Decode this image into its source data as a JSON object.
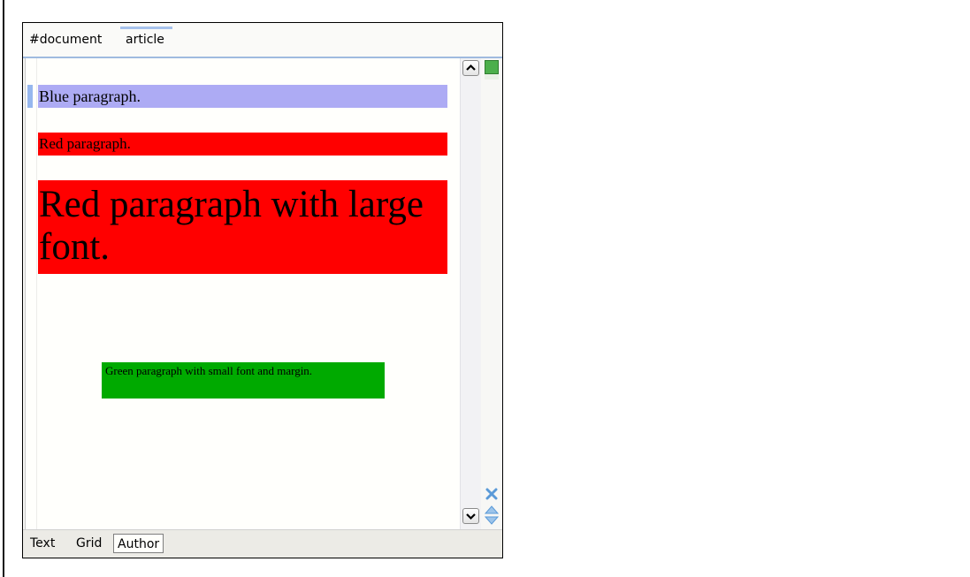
{
  "breadcrumb": {
    "items": [
      "#document",
      "article"
    ],
    "selected": "article"
  },
  "document": {
    "paragraphs": [
      {
        "id": "blue",
        "text": "Blue paragraph.",
        "background": "#adabf4"
      },
      {
        "id": "red",
        "text": "Red paragraph.",
        "background": "#ff0000"
      },
      {
        "id": "red-large",
        "text": "Red paragraph with large font.",
        "background": "#ff0000"
      },
      {
        "id": "green",
        "text": "Green paragraph with small font and margin.",
        "background": "#00aa00"
      }
    ]
  },
  "gutter": {
    "status_color": "#4caf4c",
    "icons": [
      "scroll-up-icon",
      "scroll-down-icon",
      "close-icon",
      "navigate-up-down-icon"
    ]
  },
  "tabs": {
    "items": [
      "Text",
      "Grid",
      "Author"
    ],
    "active": "Author"
  },
  "colors": {
    "breadcrumb_selection": "#a7c2ec",
    "icon_blue": "#5a9ad8"
  }
}
